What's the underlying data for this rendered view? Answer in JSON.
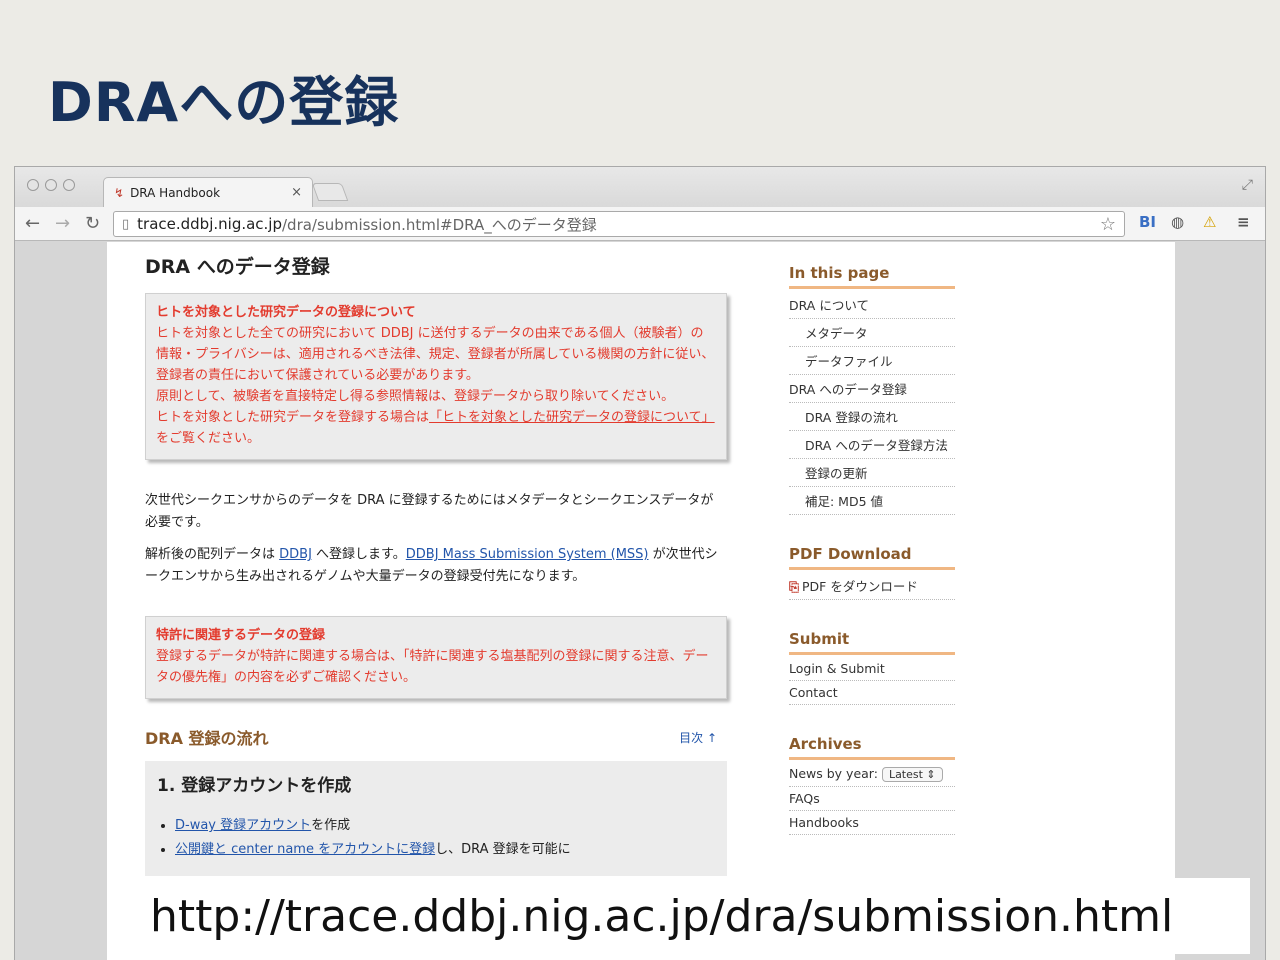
{
  "slide": {
    "title": "DRAへの登録"
  },
  "browser": {
    "tab_title": "DRA Handbook",
    "tab_close": "×",
    "url_domain": "trace.ddbj.nig.ac.jp",
    "url_path": "/dra/submission.html#DRA_へのデータ登録",
    "ext_bi": "BI"
  },
  "main": {
    "heading": "DRA へのデータ登録",
    "notice1": {
      "title": "ヒトを対象とした研究データの登録について",
      "body1": "ヒトを対象とした全ての研究において DDBJ に送付するデータの由来である個人（被験者）の情報・プライバシーは、適用されるべき法律、規定、登録者が所属している機関の方針に従い、登録者の責任において保護されている必要があります。",
      "body2": "原則として、被験者を直接特定し得る参照情報は、登録データから取り除いてください。",
      "body3": "ヒトを対象とした研究データを登録する場合は",
      "link": "「ヒトを対象とした研究データの登録について」",
      "body4": "をご覧ください。"
    },
    "para1": "次世代シークエンサからのデータを DRA に登録するためにはメタデータとシークエンスデータが必要です。",
    "para2_a": "解析後の配列データは ",
    "para2_link1": "DDBJ",
    "para2_b": " へ登録します。",
    "para2_link2": "DDBJ Mass Submission System (MSS)",
    "para2_c": " が次世代シークエンサから生み出されるゲノムや大量データの登録受付先になります。",
    "notice2": {
      "title": "特許に関連するデータの登録",
      "body": "登録するデータが特許に関連する場合は、「特許に関連する塩基配列の登録に関する注意、データの優先権」の内容を必ずご確認ください。"
    },
    "section_title": "DRA 登録の流れ",
    "toc_link": "目次 ↑",
    "step1": {
      "title": "1. 登録アカウントを作成",
      "item1_link": "D-way 登録アカウント",
      "item1_text": "を作成",
      "item2_link": "公開鍵と center name をアカウントに登録",
      "item2_text": "し、DRA 登録を可能に"
    }
  },
  "sidebar": {
    "in_this_page": {
      "heading": "In this page",
      "items": [
        "DRA について",
        "メタデータ",
        "データファイル",
        "DRA へのデータ登録",
        "DRA 登録の流れ",
        "DRA へのデータ登録方法",
        "登録の更新",
        "補足: MD5 値"
      ]
    },
    "pdf": {
      "heading": "PDF Download",
      "item": "PDF をダウンロード"
    },
    "submit": {
      "heading": "Submit",
      "items": [
        "Login & Submit",
        "Contact"
      ]
    },
    "archives": {
      "heading": "Archives",
      "news_label": "News by year:",
      "news_select": "Latest",
      "items": [
        "FAQs",
        "Handbooks"
      ]
    }
  },
  "caption": {
    "url": "http://trace.ddbj.nig.ac.jp/dra/submission.html"
  }
}
